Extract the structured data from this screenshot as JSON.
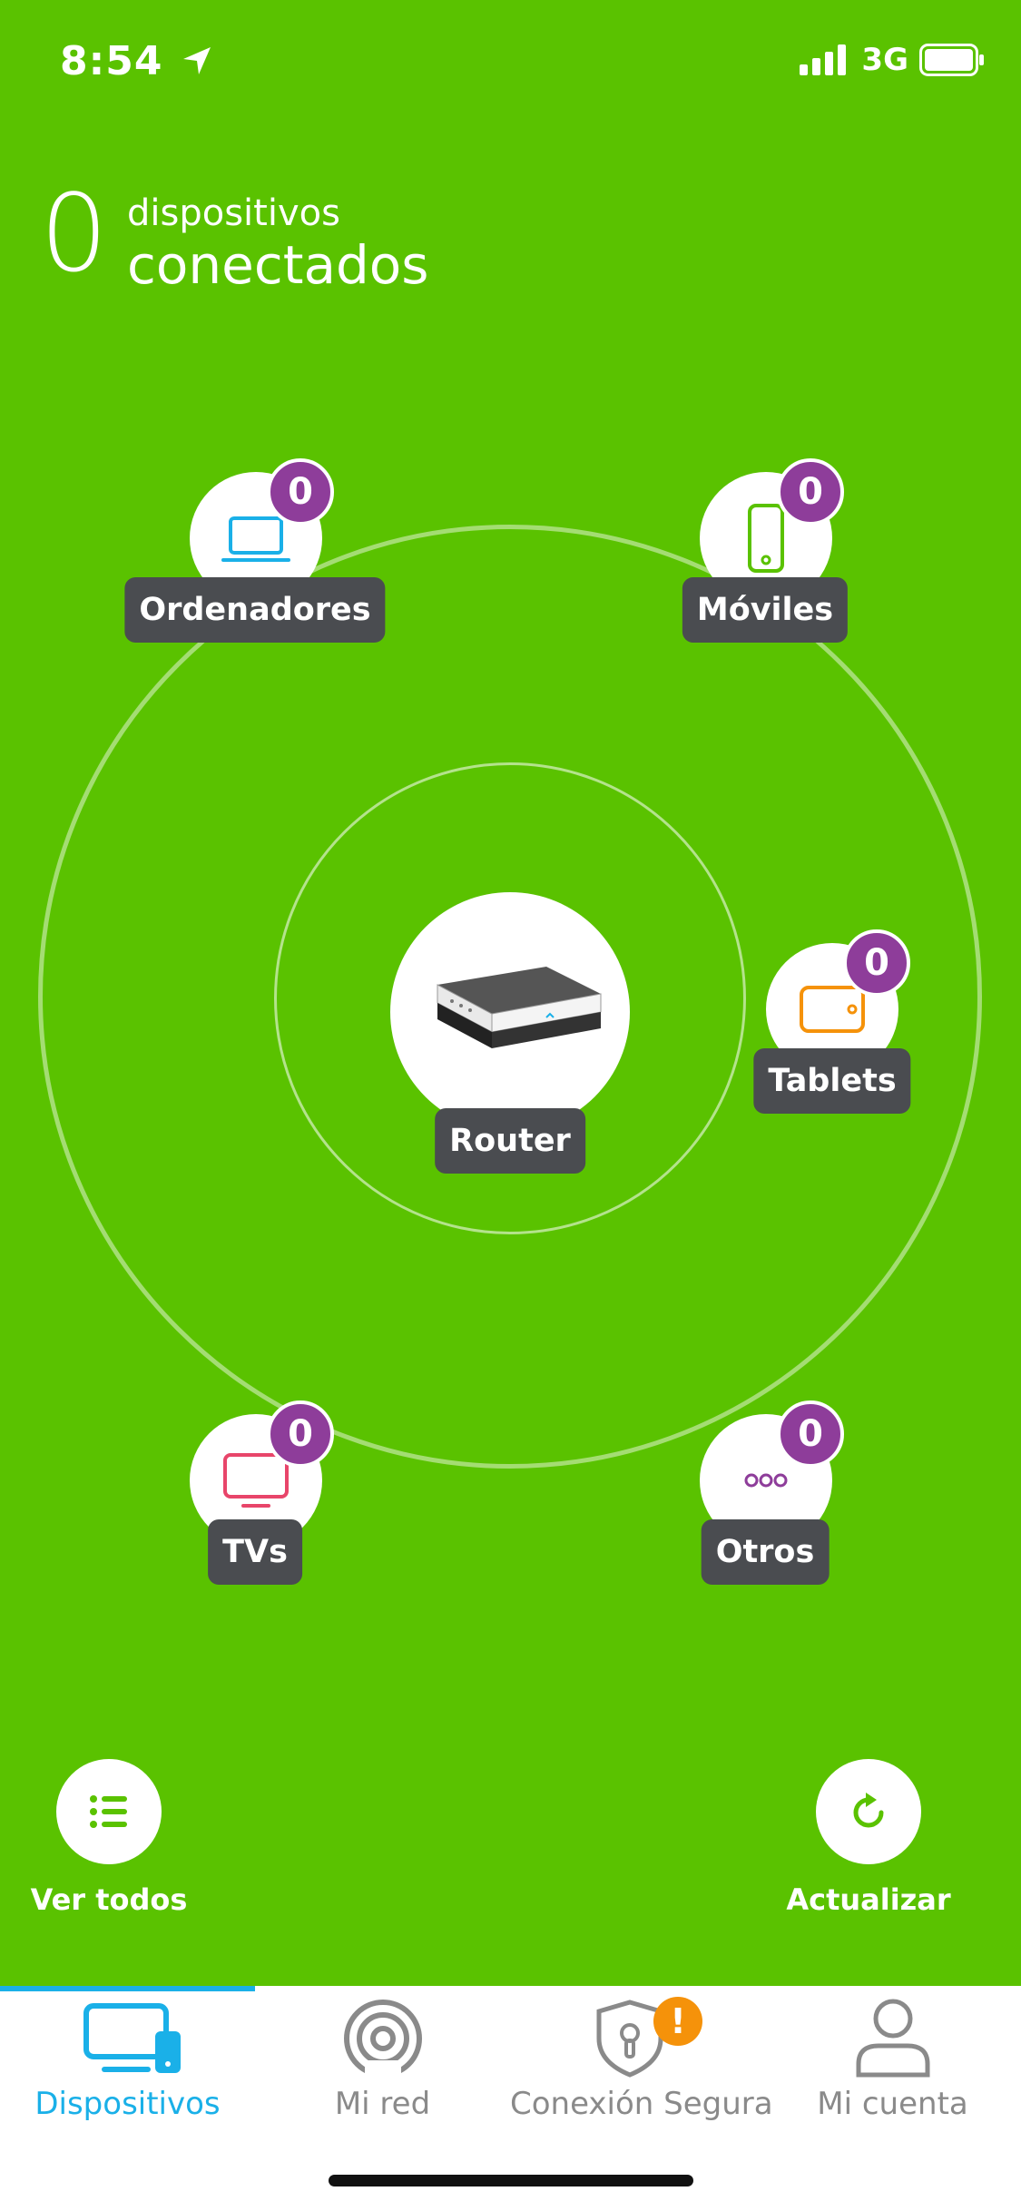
{
  "status_bar": {
    "time": "8:54",
    "network": "3G"
  },
  "header": {
    "count": "0",
    "line1": "dispositivos",
    "line2": "conectados"
  },
  "devices": {
    "ordenadores": {
      "label": "Ordenadores",
      "count": "0"
    },
    "moviles": {
      "label": "Móviles",
      "count": "0"
    },
    "tablets": {
      "label": "Tablets",
      "count": "0"
    },
    "tvs": {
      "label": "TVs",
      "count": "0"
    },
    "otros": {
      "label": "Otros",
      "count": "0"
    }
  },
  "router": {
    "label": "Router"
  },
  "actions": {
    "ver_todos": "Ver todos",
    "actualizar": "Actualizar"
  },
  "tabs": [
    {
      "label": "Dispositivos",
      "icon": "devices-icon",
      "active": true
    },
    {
      "label": "Mi red",
      "icon": "network-icon",
      "active": false
    },
    {
      "label": "Conexión Segura",
      "icon": "shield-lock-icon",
      "active": false,
      "alert": "!"
    },
    {
      "label": "Mi cuenta",
      "icon": "user-icon",
      "active": false
    }
  ],
  "colors": {
    "background": "#5ac200",
    "badge": "#8e3d9a",
    "label_bg": "#4a4c50",
    "active_tab": "#1ab0e8",
    "alert": "#f5920a"
  }
}
